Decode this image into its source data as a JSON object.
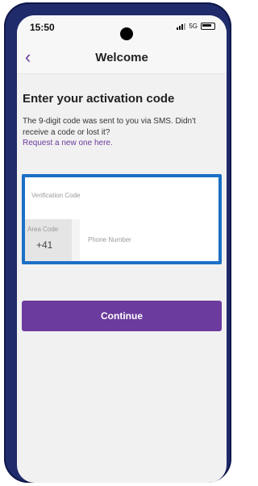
{
  "status_bar": {
    "time": "15:50",
    "network": "5G"
  },
  "nav": {
    "back_icon": "chevron-left-icon",
    "title": "Welcome"
  },
  "content": {
    "heading": "Enter your activation code",
    "description": "The 9-digit code was sent to you via SMS. Didn't receive a code or lost it?",
    "request_link": "Request a new one here.",
    "verification_placeholder": "Verification Code",
    "area_code_label": "Area Code",
    "area_code_value": "+41",
    "phone_placeholder": "Phone Number",
    "continue_label": "Continue"
  },
  "colors": {
    "accent": "#6b3b9d",
    "highlight_border": "#1c6fc5",
    "frame": "#1f2b6a"
  }
}
